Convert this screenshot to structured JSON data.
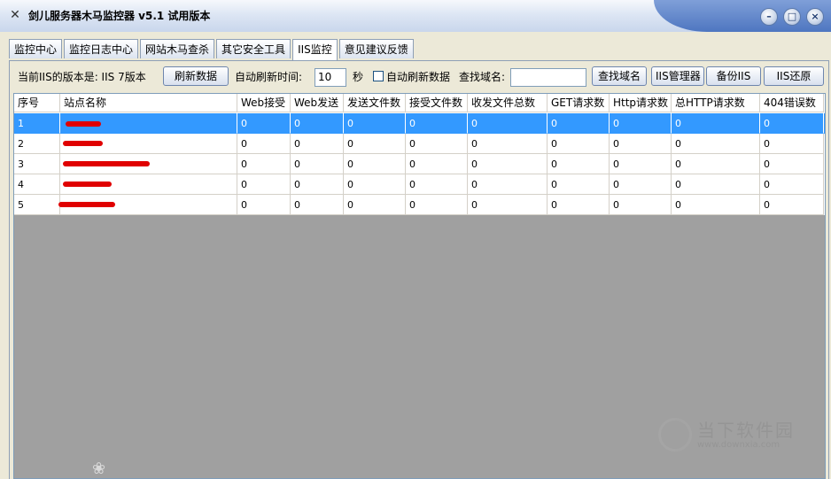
{
  "window": {
    "title": "剑儿服务器木马监控器 v5.1  试用版本",
    "icon": "crossed-swords-icon",
    "controls": [
      "minimize-icon",
      "maximize-icon",
      "close-icon"
    ]
  },
  "tabs": [
    "监控中心",
    "监控日志中心",
    "网站木马查杀",
    "其它安全工具",
    "IIS监控",
    "意见建议反馈"
  ],
  "active_tab": "IIS监控",
  "toolbar": {
    "iis_version_label": "当前IIS的版本是: IIS 7版本",
    "refresh_button": "刷新数据",
    "auto_refresh_time_label": "自动刷新时间:",
    "auto_refresh_value": "10",
    "seconds_label": "秒",
    "auto_refresh_checkbox_label": "自动刷新数据",
    "find_domain_label": "查找域名:",
    "find_domain_value": "",
    "find_domain_button": "查找域名",
    "iis_manager_button": "IIS管理器",
    "backup_iis_button": "备份IIS",
    "restore_iis_button": "IIS还原"
  },
  "table": {
    "columns": [
      "序号",
      "站点名称",
      "Web接受",
      "Web发送",
      "发送文件数",
      "接受文件数",
      "收发文件总数",
      "GET请求数",
      "Http请求数",
      "总HTTP请求数",
      "404错误数"
    ],
    "rows": [
      {
        "id": "1",
        "site": "",
        "values": [
          "0",
          "0",
          "0",
          "0",
          "0",
          "0",
          "0",
          "0",
          "0"
        ]
      },
      {
        "id": "2",
        "site": "",
        "values": [
          "0",
          "0",
          "0",
          "0",
          "0",
          "0",
          "0",
          "0",
          "0"
        ]
      },
      {
        "id": "3",
        "site": "",
        "values": [
          "0",
          "0",
          "0",
          "0",
          "0",
          "0",
          "0",
          "0",
          "0"
        ]
      },
      {
        "id": "4",
        "site": "",
        "values": [
          "0",
          "0",
          "0",
          "0",
          "0",
          "0",
          "0",
          "0",
          "0"
        ]
      },
      {
        "id": "5",
        "site": "",
        "values": [
          "0",
          "0",
          "0",
          "0",
          "0",
          "0",
          "0",
          "0",
          "0"
        ]
      }
    ],
    "selected_row": 0
  },
  "watermark": {
    "text": "当下软件园",
    "url": "www.downxia.com"
  },
  "colors": {
    "selection": "#3399FF",
    "redaction": "#E00000",
    "list_background": "#A0A0A0"
  }
}
